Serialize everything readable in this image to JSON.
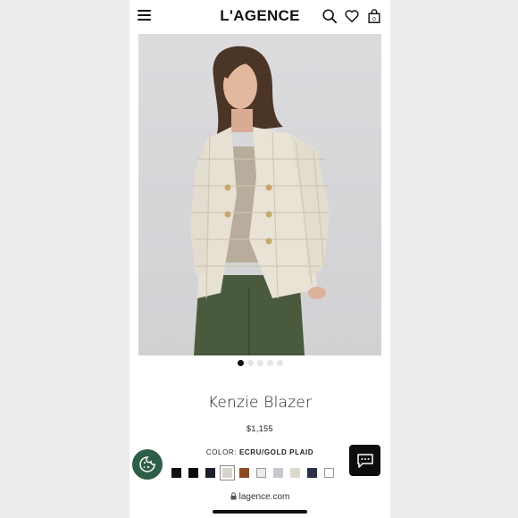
{
  "header": {
    "logo": "L'AGENCE",
    "icons": [
      "menu-icon",
      "search-icon",
      "heart-icon",
      "bag-icon"
    ]
  },
  "gallery": {
    "dot_count": 5,
    "active_index": 0
  },
  "product": {
    "name": "Kenzie Blazer",
    "price": "$1,155",
    "color_label": "COLOR:",
    "color_value": "ECRU/GOLD PLAID",
    "swatches": [
      "#111111",
      "#0a0a0a",
      "#1b1f2e",
      "#d7d4cb",
      "#8f4a22",
      "#ebebeb",
      "#c6c8d0",
      "#ddd9cf",
      "#2a3047",
      "#ffffff"
    ],
    "selected_swatch": 3
  },
  "browser": {
    "url": "lagence.com"
  },
  "colors": {
    "cookie_button": "#2f5e46",
    "chat_button": "#0d0d0d"
  }
}
